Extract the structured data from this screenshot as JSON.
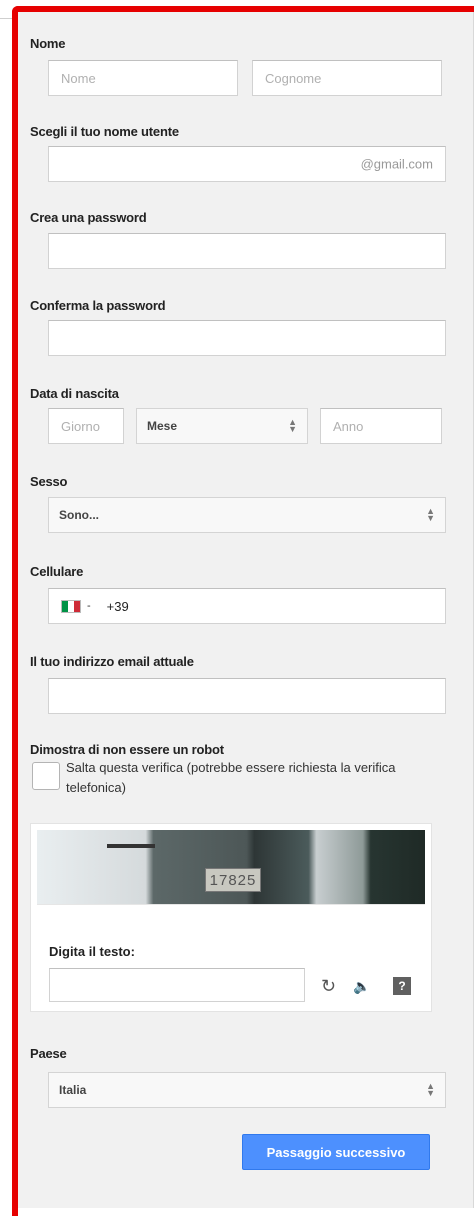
{
  "name": {
    "label": "Nome",
    "first_placeholder": "Nome",
    "last_placeholder": "Cognome"
  },
  "username": {
    "label": "Scegli il tuo nome utente",
    "suffix": "@gmail.com"
  },
  "password": {
    "label": "Crea una password"
  },
  "confirm_password": {
    "label": "Conferma la password"
  },
  "birthdate": {
    "label": "Data di nascita",
    "day_placeholder": "Giorno",
    "month_value": "Mese",
    "year_placeholder": "Anno"
  },
  "gender": {
    "label": "Sesso",
    "value": "Sono..."
  },
  "mobile": {
    "label": "Cellulare",
    "flag_colors": [
      "#009246",
      "#ffffff",
      "#ce2b37"
    ],
    "flag_arrow": "-",
    "prefix": "+39"
  },
  "current_email": {
    "label": "Il tuo indirizzo email attuale"
  },
  "robot": {
    "label": "Dimostra di non essere un robot",
    "skip_text": "Salta questa verifica (potrebbe essere richiesta la verifica telefonica)"
  },
  "captcha": {
    "image_number": "17825",
    "prompt": "Digita il testo:",
    "refresh_icon": "refresh-icon",
    "audio_icon": "audio-icon",
    "help_icon": "help-icon",
    "help_glyph": "?"
  },
  "country": {
    "label": "Paese",
    "value": "Italia"
  },
  "submit": {
    "label": "Passaggio successivo",
    "color": "#4d90fe"
  }
}
